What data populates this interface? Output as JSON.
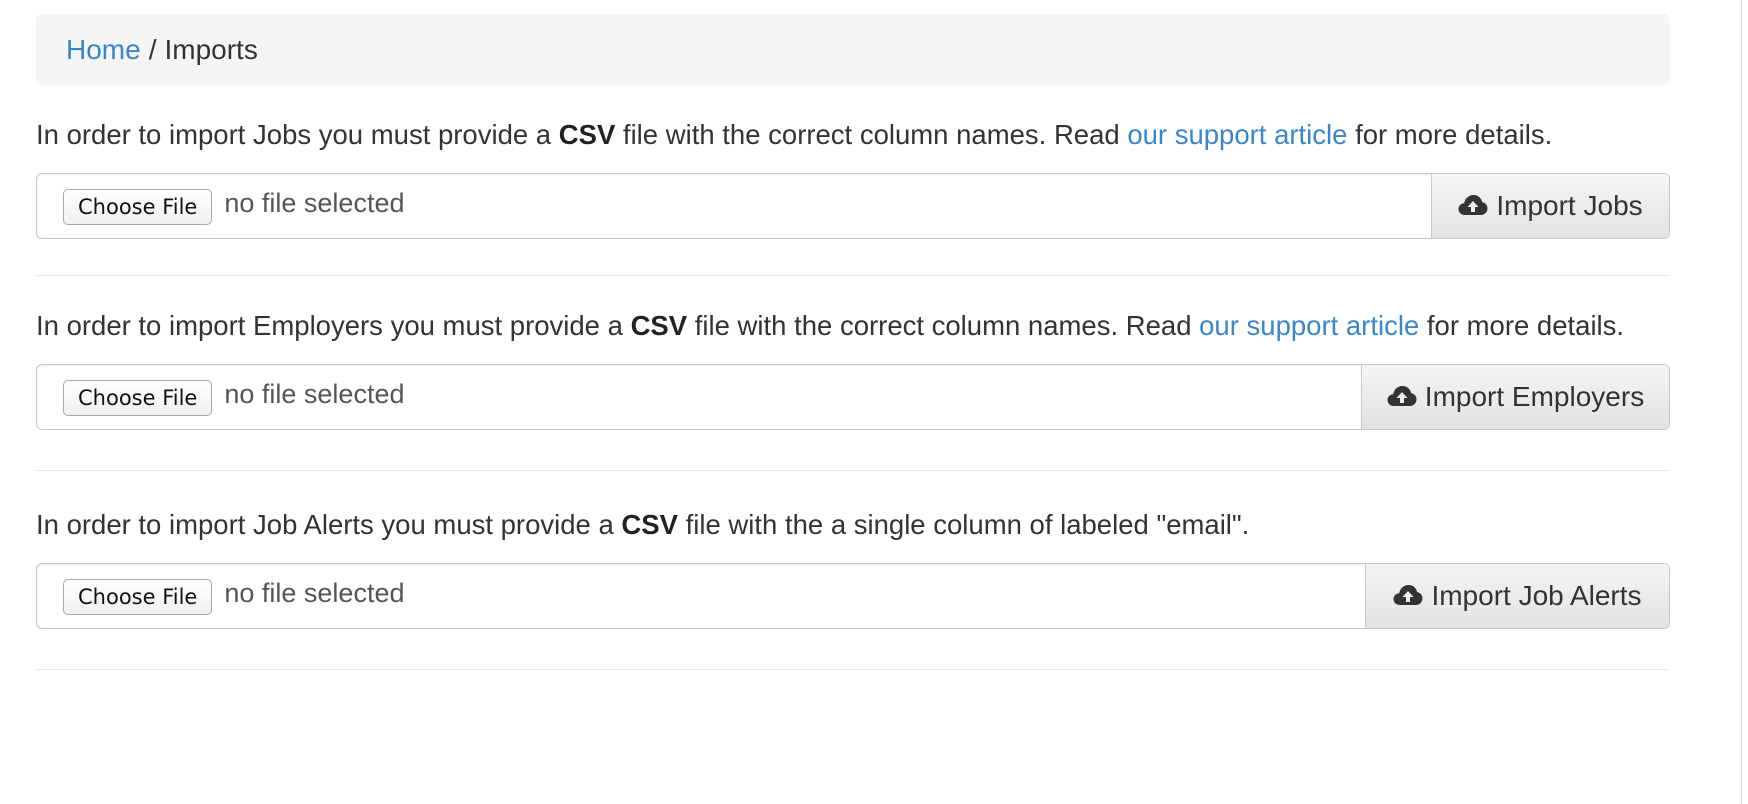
{
  "breadcrumb": {
    "home": "Home",
    "separator": "/",
    "current": "Imports"
  },
  "sections": [
    {
      "id": "jobs",
      "desc_prefix": "In order to import Jobs you must provide a ",
      "desc_bold": "CSV",
      "desc_middle": " file with the correct column names. Read ",
      "desc_link": "our support article",
      "desc_suffix": " for more details.",
      "choose_label": "Choose File",
      "file_status": "no file selected",
      "import_label": "Import Jobs",
      "icon": "cloud-upload-icon"
    },
    {
      "id": "employers",
      "desc_prefix": "In order to import Employers you must provide a ",
      "desc_bold": "CSV",
      "desc_middle": " file with the correct column names. Read ",
      "desc_link": "our support article",
      "desc_suffix": " for more details.",
      "choose_label": "Choose File",
      "file_status": "no file selected",
      "import_label": "Import Employers",
      "icon": "cloud-upload-icon"
    },
    {
      "id": "job-alerts",
      "desc_prefix": "In order to import Job Alerts you must provide a ",
      "desc_bold": "CSV",
      "desc_suffix": " file with the a single column of labeled \"email\".",
      "choose_label": "Choose File",
      "file_status": "no file selected",
      "import_label": "Import Job Alerts",
      "icon": "cloud-upload-icon"
    }
  ],
  "colors": {
    "link": "#3a86c8",
    "breadcrumb_bg": "#f5f5f5",
    "text": "#333333"
  }
}
